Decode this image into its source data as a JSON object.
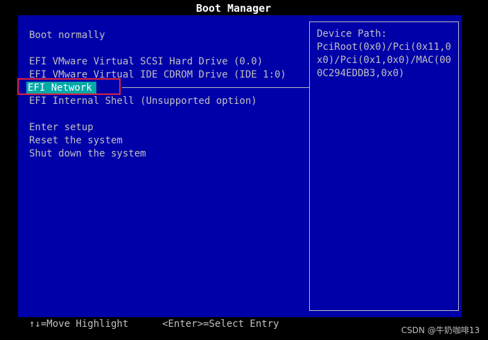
{
  "title": "Boot Manager",
  "menu": {
    "items": [
      {
        "label": "Boot normally"
      },
      {
        "label": "EFI VMware Virtual SCSI Hard Drive (0.0)"
      },
      {
        "label": "EFI VMware Virtual IDE CDROM Drive (IDE 1:0)"
      },
      {
        "label": "EFI Network",
        "selected": true
      },
      {
        "label": "EFI Internal Shell (Unsupported option)"
      },
      {
        "label": "Enter setup"
      },
      {
        "label": "Reset the system"
      },
      {
        "label": "Shut down the system"
      }
    ]
  },
  "device_path": {
    "label": "Device Path:",
    "value": "PciRoot(0x0)/Pci(0x11,0x0)/Pci(0x1,0x0)/MAC(000C294EDDB3,0x0)"
  },
  "footer": {
    "move_hint": "↑↓=Move Highlight",
    "select_hint": "<Enter>=Select Entry"
  },
  "watermark": "CSDN @牛奶咖啡13",
  "colors": {
    "background": "#0000a8",
    "selection": "#00a8a8",
    "annotation_box": "#e0243a"
  }
}
